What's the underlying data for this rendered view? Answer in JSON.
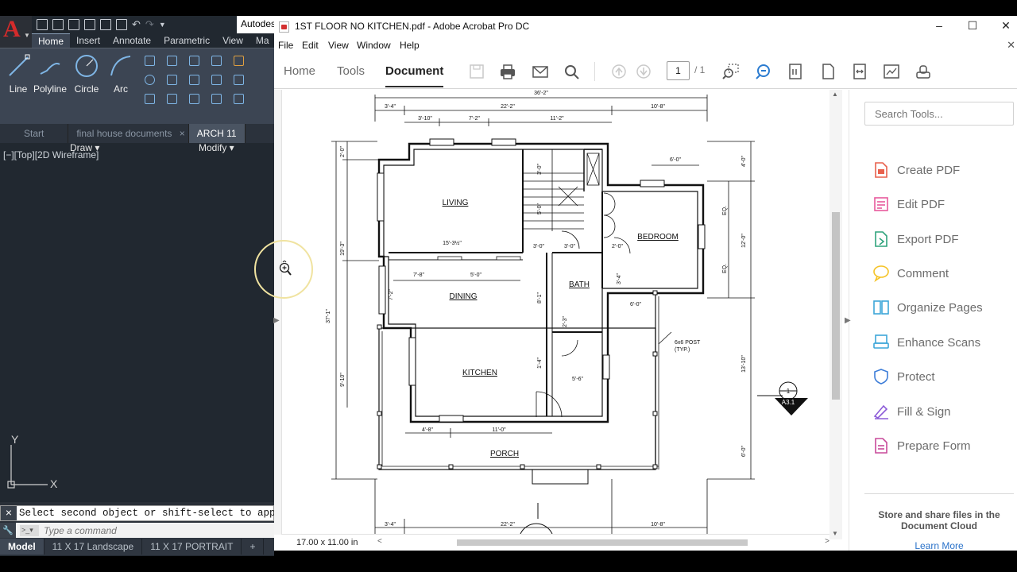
{
  "autocad": {
    "logo": "A",
    "title_partial": "Autodes",
    "ribbon_tabs": [
      "Home",
      "Insert",
      "Annotate",
      "Parametric",
      "View",
      "Ma"
    ],
    "draw_tools": [
      {
        "label": "Line",
        "icon": "line-icon"
      },
      {
        "label": "Polyline",
        "icon": "polyline-icon"
      },
      {
        "label": "Circle",
        "icon": "circle-icon"
      },
      {
        "label": "Arc",
        "icon": "arc-icon"
      }
    ],
    "panel_draw": "Draw ▾",
    "panel_modify": "Modify ▾",
    "file_tabs": [
      "Start",
      "final house documents",
      "ARCH 11"
    ],
    "file_tab_close": "×",
    "viewport_label": "[−][Top][2D Wireframe]",
    "ucs_y": "Y",
    "ucs_x": "X",
    "command_history": "Select second object or shift-select to apply co",
    "command_placeholder": "Type a command",
    "layout_tabs": [
      "Model",
      "11 X 17 Landscape",
      "11 X 17 PORTRAIT"
    ],
    "layout_add": "+"
  },
  "acrobat": {
    "title": "1ST FLOOR NO KITCHEN.pdf - Adobe Acrobat Pro DC",
    "menu": [
      "File",
      "Edit",
      "View",
      "Window",
      "Help"
    ],
    "nav_tabs": [
      "Home",
      "Tools",
      "Document"
    ],
    "active_tab": "Document",
    "page_current": "1",
    "page_total": "/  1",
    "status_dims": "17.00 x 11.00 in",
    "search_placeholder": "Search Tools...",
    "tools": [
      {
        "label": "Create PDF",
        "icon": "create-pdf-icon",
        "color": "#e8614d"
      },
      {
        "label": "Edit PDF",
        "icon": "edit-pdf-icon",
        "color": "#e85a9c"
      },
      {
        "label": "Export PDF",
        "icon": "export-pdf-icon",
        "color": "#2fa37c"
      },
      {
        "label": "Comment",
        "icon": "comment-icon",
        "color": "#f5c326"
      },
      {
        "label": "Organize Pages",
        "icon": "organize-pages-icon",
        "color": "#3da6d8"
      },
      {
        "label": "Enhance Scans",
        "icon": "enhance-scans-icon",
        "color": "#3da6d8"
      },
      {
        "label": "Protect",
        "icon": "protect-icon",
        "color": "#3d7dd8"
      },
      {
        "label": "Fill & Sign",
        "icon": "fill-sign-icon",
        "color": "#8c5bd8"
      },
      {
        "label": "Prepare Form",
        "icon": "prepare-form-icon",
        "color": "#c84a9a"
      }
    ],
    "cloud_text": "Store and share files in the Document Cloud",
    "learn_more": "Learn More"
  },
  "plan": {
    "rooms": [
      "LIVING",
      "DINING",
      "KITCHEN",
      "BATH",
      "BEDROOM",
      "PORCH"
    ],
    "dims": {
      "top_total": "36'-2\"",
      "top_a": "3'-4\"",
      "top_b": "22'-2\"",
      "top_c": "10'-8\"",
      "top_d": "3'-10\"",
      "top_e": "7'-2\"",
      "top_f": "11'-2\"",
      "bed_top": "6'-0\"",
      "left_a": "2'-0\"",
      "left_total": "37'-1\"",
      "left_b": "19'-3\"",
      "left_c": "9'-10\"",
      "din_a": "7'-8\"",
      "din_b": "5'-0\"",
      "din_v": "7'-2\"",
      "living_size": "15'-3½\"",
      "stair_a": "3'-0\"",
      "stair_b": "3'-0\"",
      "stair_c": "5'-0\"",
      "hall_a": "3'-0\"",
      "hall_b": "3'-0\"",
      "bed_door": "2'-0\"",
      "bath_v": "3'-4\"",
      "bath_h": "6'-0\"",
      "hall_v": "8'-1\"",
      "closet_v": "2'-3\"",
      "closet_h": "5'-6\"",
      "kit_v": "1'-4\"",
      "right_a": "4'-0\"",
      "right_eq1": "EQ.",
      "right_b": "12'-0\"",
      "right_eq2": "EQ.",
      "right_c": "13'-10\"",
      "right_d": "6'-0\"",
      "bot_a": "4'-8\"",
      "bot_b": "11'-0\"",
      "bot2_a": "3'-4\"",
      "bot2_b": "22'-2\"",
      "bot2_c": "10'-8\""
    },
    "post_note_1": "6x6 POST",
    "post_note_2": "(TYP.)",
    "section_num": "1",
    "section_sheet": "A3.1"
  }
}
